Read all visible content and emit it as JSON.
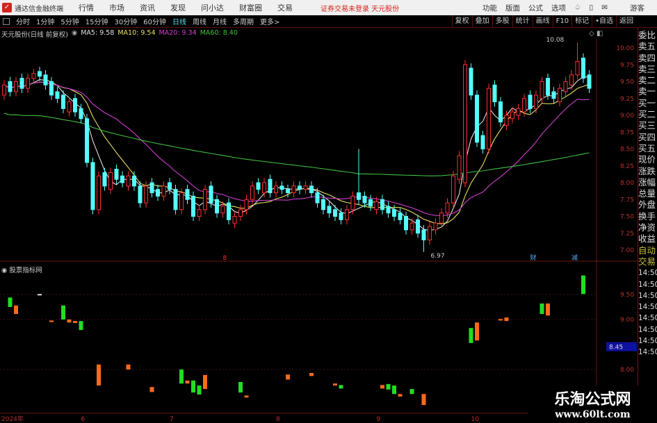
{
  "app": {
    "title": "通达信金融终端",
    "menu": [
      "行情",
      "市场",
      "资讯",
      "发现",
      "问小达",
      "财富圈",
      "交易"
    ],
    "notice": "证券交易未登录 天元股份",
    "right_menu": [
      "功能",
      "版面",
      "公式",
      "选项"
    ],
    "user": "游客"
  },
  "toolbar": {
    "periods": [
      "分时",
      "1分钟",
      "5分钟",
      "15分钟",
      "30分钟",
      "60分钟",
      "日线",
      "周线",
      "月线",
      "多周期",
      "更多>"
    ],
    "active": "日线",
    "buttons": [
      "复权",
      "叠加",
      "多股",
      "统计",
      "画线",
      "F10",
      "标记",
      "•自选",
      "返回"
    ]
  },
  "info": {
    "stock": "天元股份(日线 前复权)",
    "ma5": "MA5: 9.58",
    "ma10": "MA10: 9.54",
    "ma20": "MA20: 9.34",
    "ma60": "MA60: 8.40"
  },
  "indicator": {
    "name": "股票指标网"
  },
  "right_panel": [
    "委比",
    "卖五",
    "卖四",
    "卖三",
    "卖二",
    "卖一",
    "买一",
    "买二",
    "买三",
    "买四",
    "买五",
    "现价",
    "涨跌",
    "涨幅",
    "总量",
    "外盘",
    "换手",
    "净资",
    "收益",
    "自动",
    "交易",
    "14:50",
    "14:50",
    "14:50",
    "14:50",
    "14:50",
    "14:50",
    "14:50",
    "14:50"
  ],
  "watermark": {
    "line1": "乐淘公式网",
    "line2": "www.60lt.com"
  },
  "colors": {
    "up": "#ff3030",
    "down": "#54ffff",
    "ma5": "#e0e0e0",
    "ma10": "#e8e060",
    "ma20": "#d040d0",
    "ma60": "#40c040",
    "ind_green": "#22dd22",
    "ind_orange": "#ff6a1a",
    "axis": "#c03030"
  },
  "chart_data": [
    {
      "type": "candlestick",
      "title": "天元股份(日线 前复权)",
      "ylim": [
        6.9,
        10.1
      ],
      "yticks": [
        "10.00",
        "9.75",
        "9.50",
        "9.25",
        "9.00",
        "8.75",
        "8.50",
        "8.25",
        "8.00",
        "7.75",
        "7.50",
        "7.25",
        "7.00"
      ],
      "open": [
        9.3,
        9.5,
        9.35,
        9.55,
        9.4,
        9.55,
        9.65,
        9.6,
        9.5,
        9.35,
        9.3,
        9.05,
        9.25,
        9.1,
        8.95,
        8.3,
        7.6,
        8.15,
        7.9,
        8.2,
        8.1,
        7.95,
        8.1,
        7.95,
        7.7,
        8.0,
        7.9,
        7.8,
        8.0,
        7.9,
        7.6,
        7.9,
        7.8,
        7.5,
        7.6,
        7.95,
        7.75,
        7.55,
        7.7,
        7.4,
        7.5,
        7.6,
        7.75,
        8.0,
        7.85,
        8.05,
        7.85,
        7.95,
        7.9,
        7.85,
        7.95,
        7.9,
        7.95,
        7.85,
        7.75,
        7.65,
        7.6,
        7.55,
        7.45,
        7.6,
        7.85,
        7.8,
        7.75,
        7.6,
        7.75,
        7.65,
        7.6,
        7.55,
        7.5,
        7.3,
        7.45,
        7.3,
        7.15,
        7.3,
        7.4,
        7.55,
        7.7,
        8.05,
        8.0,
        9.7,
        9.3,
        8.7,
        8.5,
        9.45,
        9.2,
        8.85,
        8.95,
        9.0,
        9.05,
        9.3,
        9.1,
        9.25,
        9.55,
        9.35,
        9.2,
        9.35,
        9.45,
        9.6,
        9.85,
        9.6
      ],
      "close": [
        9.45,
        9.35,
        9.5,
        9.4,
        9.55,
        9.62,
        9.58,
        9.45,
        9.3,
        9.25,
        9.1,
        9.2,
        9.05,
        8.95,
        8.3,
        7.6,
        8.1,
        7.95,
        8.15,
        8.05,
        8.0,
        8.1,
        7.95,
        7.7,
        7.95,
        7.85,
        7.8,
        7.95,
        7.9,
        7.6,
        7.85,
        7.75,
        7.5,
        7.6,
        7.9,
        7.7,
        7.55,
        7.65,
        7.45,
        7.5,
        7.6,
        7.75,
        7.95,
        7.9,
        8.0,
        7.85,
        7.95,
        7.9,
        7.85,
        7.95,
        7.9,
        7.95,
        7.85,
        7.7,
        7.6,
        7.55,
        7.5,
        7.45,
        7.6,
        7.8,
        7.75,
        7.7,
        7.65,
        7.72,
        7.6,
        7.55,
        7.5,
        7.45,
        7.3,
        7.4,
        7.25,
        7.15,
        7.35,
        7.4,
        7.55,
        7.7,
        8.1,
        8.4,
        9.75,
        9.3,
        8.6,
        8.5,
        9.4,
        9.2,
        8.9,
        9.0,
        9.05,
        9.1,
        9.25,
        9.1,
        9.3,
        9.5,
        9.3,
        9.25,
        9.4,
        9.5,
        9.6,
        9.8,
        9.55,
        9.4
      ],
      "annotations": [
        {
          "label": "10.08",
          "value": 10.08,
          "index": 97
        },
        {
          "label": "6.97",
          "value": 6.97,
          "index": 71
        }
      ],
      "markers": [
        {
          "label": "8",
          "index": 37
        },
        {
          "label": "财",
          "index": 89
        },
        {
          "label": "减",
          "index": 96
        }
      ]
    },
    {
      "type": "bar",
      "title": "股票指标网",
      "ylim": [
        7.3,
        9.95
      ],
      "yticks": [
        "9.50",
        "9.00",
        "8.00"
      ],
      "current": "8.45",
      "bars": [
        [
          1,
          9.44,
          9.25,
          "green"
        ],
        [
          2,
          9.28,
          9.11,
          "orange"
        ],
        [
          6,
          9.51,
          9.49,
          "white"
        ],
        [
          8,
          8.98,
          8.95,
          "orange"
        ],
        [
          10,
          9.28,
          9.0,
          "green"
        ],
        [
          11,
          9.0,
          8.94,
          "orange"
        ],
        [
          12,
          8.97,
          8.93,
          "orange"
        ],
        [
          13,
          8.97,
          8.79,
          "green"
        ],
        [
          16,
          8.1,
          7.68,
          "orange"
        ],
        [
          21,
          8.1,
          8.0,
          "orange"
        ],
        [
          25,
          7.65,
          7.55,
          "orange"
        ],
        [
          30,
          8.0,
          7.72,
          "green"
        ],
        [
          31,
          7.78,
          7.72,
          "orange"
        ],
        [
          32,
          7.78,
          7.54,
          "green"
        ],
        [
          33,
          7.68,
          7.5,
          "green"
        ],
        [
          34,
          7.89,
          7.61,
          "orange"
        ],
        [
          40,
          7.75,
          7.54,
          "green"
        ],
        [
          41,
          7.48,
          7.44,
          "orange"
        ],
        [
          48,
          7.9,
          7.8,
          "orange"
        ],
        [
          52,
          7.93,
          7.87,
          "orange"
        ],
        [
          56,
          7.72,
          7.68,
          "orange"
        ],
        [
          57,
          7.69,
          7.62,
          "green"
        ],
        [
          64,
          7.69,
          7.62,
          "orange"
        ],
        [
          65,
          7.71,
          7.6,
          "green"
        ],
        [
          66,
          7.68,
          7.51,
          "green"
        ],
        [
          67,
          7.51,
          7.46,
          "orange"
        ],
        [
          69,
          7.61,
          7.51,
          "green"
        ],
        [
          71,
          7.51,
          7.29,
          "orange"
        ],
        [
          79,
          8.83,
          8.53,
          "green"
        ],
        [
          80,
          8.94,
          8.58,
          "orange"
        ],
        [
          84,
          9.01,
          8.98,
          "orange"
        ],
        [
          85,
          9.04,
          8.97,
          "orange"
        ],
        [
          91,
          9.32,
          9.11,
          "green"
        ],
        [
          92,
          9.32,
          9.08,
          "orange"
        ],
        [
          98,
          9.88,
          9.51,
          "green"
        ]
      ]
    }
  ],
  "date_axis": [
    {
      "label": "2024年",
      "index": 0
    },
    {
      "label": "6",
      "index": 13
    },
    {
      "label": "7",
      "index": 28
    },
    {
      "label": "8",
      "index": 46
    },
    {
      "label": "9",
      "index": 63
    },
    {
      "label": "10",
      "index": 79
    }
  ]
}
